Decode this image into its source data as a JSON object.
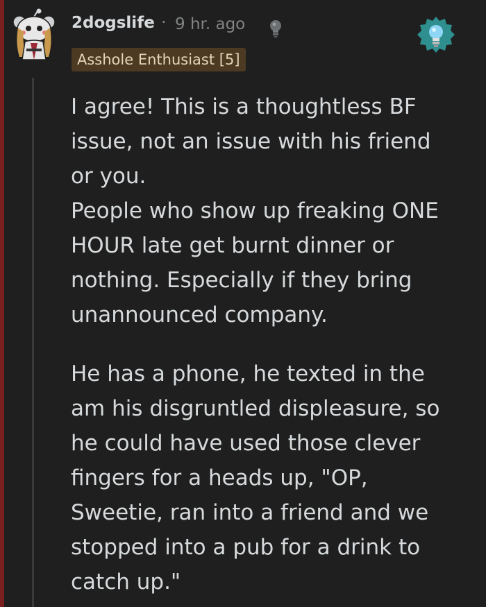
{
  "comment": {
    "author": "2dogslife",
    "separator": "·",
    "timestamp": "9 hr. ago",
    "flair": "Asshole Enthusiast [5]",
    "body_lines_p1": [
      "I agree! This is a thoughtless BF",
      "issue, not an issue with his friend",
      "or you.",
      "People who show up freaking ONE",
      "HOUR late get burnt dinner or",
      "nothing. Especially if they bring",
      "unannounced company."
    ],
    "body_lines_p2": [
      "He has a phone, he texted in the",
      "am his disgruntled displeasure, so",
      "he could have used those clever",
      "fingers for a heads up, \"OP,",
      "Sweetie, ran into a friend and we",
      "stopped into a pub for a drink to",
      "catch up.\""
    ]
  },
  "icons": {
    "avatar": "snoo-avatar-icon",
    "helpful_award": "lightbulb-icon",
    "award_badge": "lightbulb-award-icon"
  },
  "colors": {
    "background": "#1f1f1f",
    "text": "#d7dadc",
    "meta": "#818384",
    "flair_bg": "#4d3a22",
    "flair_text": "#e4d4b8",
    "thread_accent": "#7a1f1f",
    "award_teal": "#2f8f8f",
    "award_bulb": "#8fd6f5"
  }
}
